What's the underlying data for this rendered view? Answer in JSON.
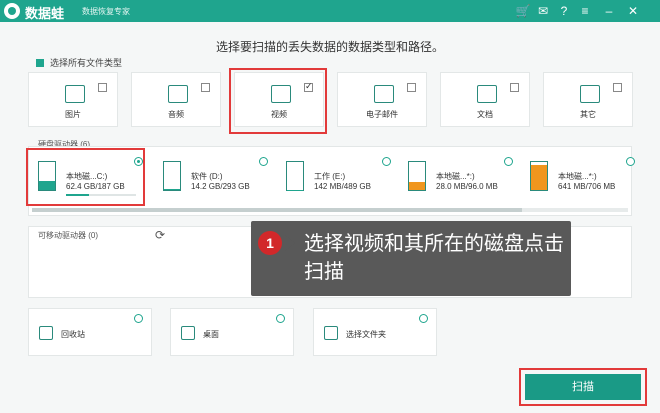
{
  "app": {
    "name": "数据蛙",
    "subtitle": "数据恢复专家"
  },
  "titlebar_icons": [
    "cart-icon",
    "chat-icon",
    "help-icon",
    "menu-icon",
    "minimize-icon",
    "close-icon"
  ],
  "main_title": "选择要扫描的丢失数据的数据类型和路径。",
  "select_all_label": "选择所有文件类型",
  "file_types": [
    {
      "label": "图片",
      "icon": "image-icon",
      "checked": false
    },
    {
      "label": "音频",
      "icon": "audio-icon",
      "checked": false
    },
    {
      "label": "视频",
      "icon": "video-icon",
      "checked": true
    },
    {
      "label": "电子邮件",
      "icon": "email-icon",
      "checked": false
    },
    {
      "label": "文档",
      "icon": "document-icon",
      "checked": false
    },
    {
      "label": "其它",
      "icon": "other-icon",
      "checked": false
    }
  ],
  "hard_drives_label": "硬盘驱动器 (6)",
  "drives": [
    {
      "name": "本地磁...C:)",
      "size": "62.4 GB/187 GB",
      "selected": true,
      "usage": 0.33,
      "fill_color": "#1fa58e"
    },
    {
      "name": "软件 (D:)",
      "size": "14.2 GB/293 GB",
      "selected": false,
      "usage": 0.05,
      "fill_color": "#1fa58e"
    },
    {
      "name": "工作 (E:)",
      "size": "142 MB/489 GB",
      "selected": false,
      "usage": 0.01,
      "fill_color": "#1fa58e"
    },
    {
      "name": "本地磁...*:)",
      "size": "28.0 MB/96.0 MB",
      "selected": false,
      "usage": 0.29,
      "fill_color": "#f0961e"
    },
    {
      "name": "本地磁...*:)",
      "size": "641 MB/706 MB",
      "selected": false,
      "usage": 0.91,
      "fill_color": "#f0961e"
    }
  ],
  "removable_label": "可移动驱动器 (0)",
  "locations": [
    {
      "label": "回收站",
      "icon": "trash-icon"
    },
    {
      "label": "桌面",
      "icon": "desktop-icon"
    },
    {
      "label": "选择文件夹",
      "icon": "folder-icon"
    }
  ],
  "tooltip": {
    "number": "1",
    "text": "选择视频和其所在的磁盘点击扫描"
  },
  "scan_button": "扫描",
  "colors": {
    "accent": "#1fa58e",
    "highlight": "#e23a3a",
    "warning": "#f0961e"
  }
}
